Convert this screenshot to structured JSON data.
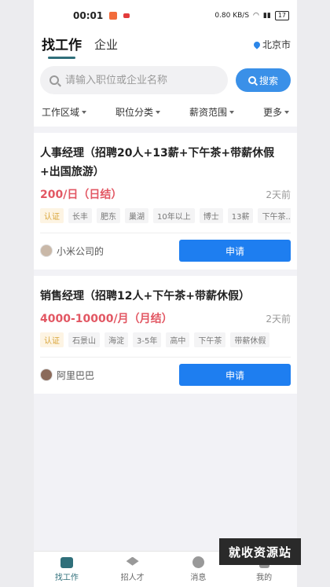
{
  "status": {
    "time": "00:01",
    "net_speed": "0.80 KB/S",
    "battery": "17"
  },
  "header": {
    "tab_jobs": "找工作",
    "tab_company": "企业",
    "city": "北京市"
  },
  "search": {
    "placeholder": "请输入职位或企业名称",
    "button_label": "搜索"
  },
  "filters": [
    "工作区域",
    "职位分类",
    "薪资范围",
    "更多"
  ],
  "jobs": [
    {
      "title": "人事经理（招聘20人+13薪+下午茶+带薪休假+出国旅游）",
      "salary": "200/日（日结）",
      "posted": "2天前",
      "tags": [
        "认证",
        "长丰",
        "肥东",
        "巢湖",
        "10年以上",
        "博士",
        "13薪",
        "下午茶..."
      ],
      "company": "小米公司的",
      "apply_label": "申请"
    },
    {
      "title": "销售经理（招聘12人+下午茶+带薪休假）",
      "salary": "4000-10000/月（月结）",
      "posted": "2天前",
      "tags": [
        "认证",
        "石景山",
        "海淀",
        "3-5年",
        "高中",
        "下午茶",
        "带薪休假"
      ],
      "company": "阿里巴巴",
      "apply_label": "申请"
    }
  ],
  "tabbar": [
    {
      "label": "找工作",
      "icon": "briefcase-icon"
    },
    {
      "label": "招人才",
      "icon": "graduation-cap-icon"
    },
    {
      "label": "消息",
      "icon": "chat-icon"
    },
    {
      "label": "我的",
      "icon": "user-icon"
    }
  ],
  "watermark": "就收资源站",
  "colors": {
    "accent": "#2f6f7a",
    "primary_button": "#1e7ef0",
    "salary": "#e25763",
    "search_button": "#3a90e8"
  }
}
